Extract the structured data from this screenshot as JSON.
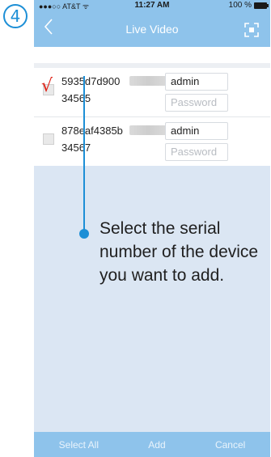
{
  "step_number": "4",
  "status_bar": {
    "carrier": "●●●○○ AT&T ᯤ",
    "time": "11:27 AM",
    "battery_percent": "100 %"
  },
  "nav": {
    "back_icon": "chevron-left-icon",
    "title": "Live Video",
    "scan_icon": "scan-icon"
  },
  "devices": [
    {
      "serial_line1": "5935d7d900",
      "serial_line2": "34565",
      "username": "admin",
      "password_placeholder": "Password",
      "checked": true
    },
    {
      "serial_line1": "878eaf4385b",
      "serial_line2": "34567",
      "username": "admin",
      "password_placeholder": "Password",
      "checked": false
    }
  ],
  "annotation": {
    "text": "Select the serial number of the device you want to add."
  },
  "bottom_bar": {
    "select_all": "Select All",
    "add": "Add",
    "cancel": "Cancel"
  },
  "colors": {
    "accent": "#1d8fd6",
    "nav_bar": "#8ec3eb",
    "check_red": "#e0261b",
    "background": "#dbe6f3"
  }
}
